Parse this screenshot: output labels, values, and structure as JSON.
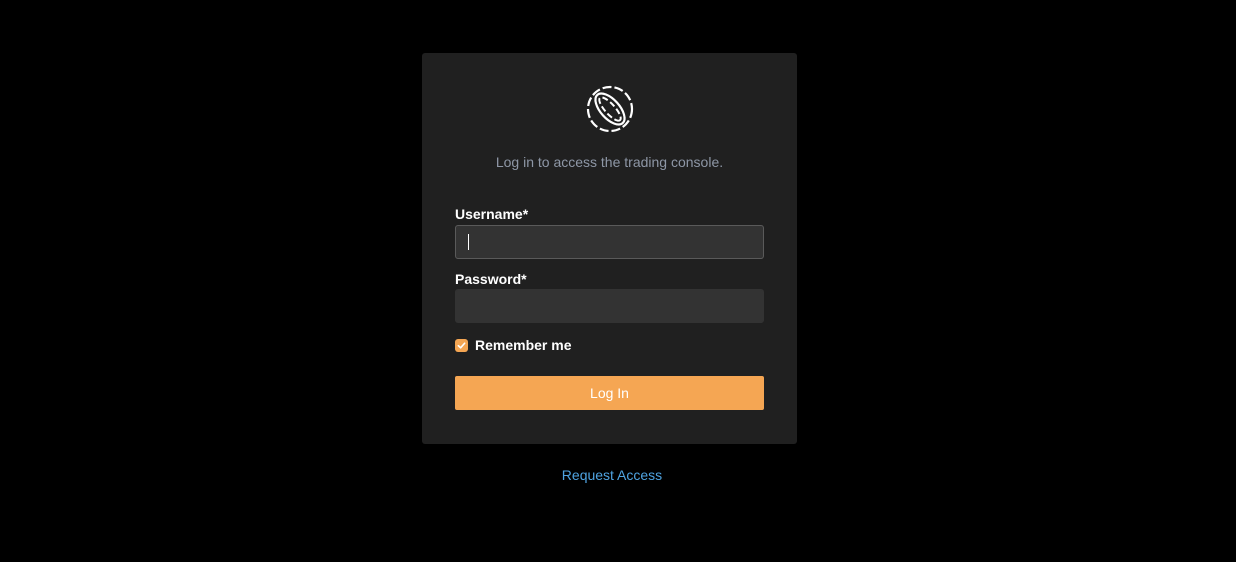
{
  "logo": {
    "icon": "globe-ring-logo-icon"
  },
  "subtitle": "Log in to access the trading console.",
  "form": {
    "username_label": "Username*",
    "username_value": "",
    "password_label": "Password*",
    "password_value": "",
    "remember_label": "Remember me",
    "remember_checked": true,
    "submit_label": "Log In"
  },
  "request_access_label": "Request Access",
  "colors": {
    "accent": "#f5a653",
    "link": "#4fa3e0",
    "card_bg": "#202020",
    "page_bg": "#000000",
    "input_bg": "#333333",
    "subtitle": "#8e97a6"
  }
}
